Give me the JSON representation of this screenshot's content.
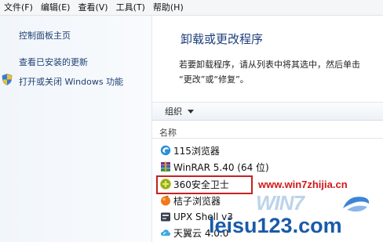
{
  "menubar": {
    "items": [
      "文件(F)",
      "编辑(E)",
      "查看(V)",
      "工具(T)",
      "帮助(H)"
    ]
  },
  "sidebar": {
    "home": "控制面板主页",
    "updates": "查看已安装的更新",
    "features": "打开或关闭 Windows 功能",
    "features_icon": "shield-icon"
  },
  "main": {
    "heading": "卸载或更改程序",
    "desc_line1": "若要卸载程序，请从列表中将其选中，然后单击",
    "desc_line2": "“更改”或“修复”。",
    "organize": "组织",
    "column_name": "名称",
    "programs": [
      {
        "name": "115浏览器",
        "icon": "browser-swirl-icon"
      },
      {
        "name": "WinRAR 5.40 (64 位)",
        "icon": "winrar-books-icon"
      },
      {
        "name": "360安全卫士",
        "icon": "360-plus-icon",
        "selected": true
      },
      {
        "name": "桔子浏览器",
        "icon": "orange-icon"
      },
      {
        "name": "UPX Shell v3",
        "icon": "upx-box-icon"
      },
      {
        "name": "天翼云 4.0.0",
        "icon": "cloud-icon"
      }
    ]
  },
  "watermark": {
    "url": "www.win7zhijia.cn",
    "win7": "WIN7",
    "leisu": "leisu123.com"
  },
  "colors": {
    "link": "#1d3f72",
    "heading": "#1e3e7a",
    "highlight": "#c42222",
    "watermark_red": "#d11818",
    "watermark_blue": "#1a5aa8"
  }
}
